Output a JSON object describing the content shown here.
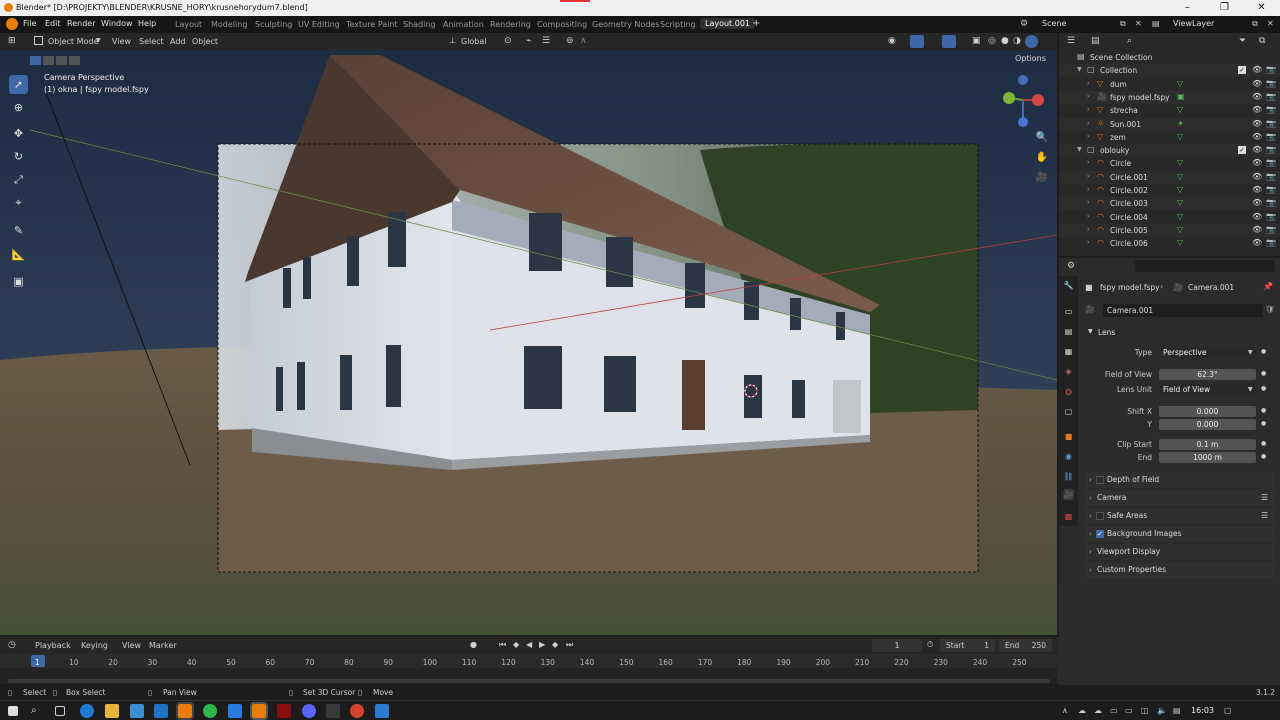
{
  "title": "Blender* [D:\\PROJEKTY\\BLENDER\\KRUSNE_HORY\\krusnehorydum7.blend]",
  "menu": [
    "File",
    "Edit",
    "Render",
    "Window",
    "Help"
  ],
  "workspaces": [
    "Layout",
    "Modeling",
    "Sculpting",
    "UV Editing",
    "Texture Paint",
    "Shading",
    "Animation",
    "Rendering",
    "Compositing",
    "Geometry Nodes",
    "Scripting",
    "Layout.001"
  ],
  "scene": "Scene",
  "viewlayer": "ViewLayer",
  "viewport": {
    "mode": "Object Mode",
    "menus": [
      "View",
      "Select",
      "Add",
      "Object"
    ],
    "orientation": "Global",
    "options": "Options",
    "overlay_title": "Camera Perspective",
    "overlay_sub": "(1) okna | fspy model.fspy"
  },
  "outliner": {
    "rows": [
      {
        "name": "Scene Collection",
        "indent": 0,
        "kind": "scene"
      },
      {
        "name": "Collection",
        "indent": 1,
        "kind": "collection"
      },
      {
        "name": "dum",
        "indent": 2,
        "kind": "mesh"
      },
      {
        "name": "fspy model.fspy",
        "indent": 2,
        "kind": "camera"
      },
      {
        "name": "strecha",
        "indent": 2,
        "kind": "mesh"
      },
      {
        "name": "Sun.001",
        "indent": 2,
        "kind": "light"
      },
      {
        "name": "zem",
        "indent": 2,
        "kind": "mesh"
      },
      {
        "name": "oblouky",
        "indent": 1,
        "kind": "collection"
      },
      {
        "name": "Circle",
        "indent": 2,
        "kind": "curve"
      },
      {
        "name": "Circle.001",
        "indent": 2,
        "kind": "curve"
      },
      {
        "name": "Circle.002",
        "indent": 2,
        "kind": "curve"
      },
      {
        "name": "Circle.003",
        "indent": 2,
        "kind": "curve"
      },
      {
        "name": "Circle.004",
        "indent": 2,
        "kind": "curve"
      },
      {
        "name": "Circle.005",
        "indent": 2,
        "kind": "curve"
      },
      {
        "name": "Circle.006",
        "indent": 2,
        "kind": "curve"
      }
    ]
  },
  "properties": {
    "breadcrumb_obj": "fspy model.fspy",
    "breadcrumb_data": "Camera.001",
    "data_name": "Camera.001",
    "lens_header": "Lens",
    "type_label": "Type",
    "type_value": "Perspective",
    "fov_label": "Field of View",
    "fov_value": "62.3°",
    "lens_unit_label": "Lens Unit",
    "lens_unit_value": "Field of View",
    "shiftx_label": "Shift X",
    "shiftx_value": "0.000",
    "shifty_label": "Y",
    "shifty_value": "0.000",
    "clipstart_label": "Clip Start",
    "clipstart_value": "0.1 m",
    "clipend_label": "End",
    "clipend_value": "1000 m",
    "panels": [
      "Depth of Field",
      "Camera",
      "Safe Areas",
      "Background Images",
      "Viewport Display",
      "Custom Properties"
    ]
  },
  "timeline": {
    "menus": [
      "Playback",
      "Keying",
      "View",
      "Marker"
    ],
    "current_frame": "1",
    "start_label": "Start",
    "start_value": "1",
    "end_label": "End",
    "end_value": "250",
    "ticks": [
      "1",
      "10",
      "20",
      "30",
      "40",
      "50",
      "60",
      "70",
      "80",
      "90",
      "100",
      "110",
      "120",
      "130",
      "140",
      "150",
      "160",
      "170",
      "180",
      "190",
      "200",
      "210",
      "220",
      "230",
      "240",
      "250"
    ]
  },
  "statusbar": {
    "select": "Select",
    "box_select": "Box Select",
    "pan_view": "Pan View",
    "set_cursor": "Set 3D Cursor",
    "move": "Move",
    "version": "3.1.2"
  },
  "taskbar": {
    "time": "16:03"
  },
  "colors": {
    "accent": "#3f68a8",
    "active_ws": "#303030",
    "selection_orange": "#e07b22"
  }
}
